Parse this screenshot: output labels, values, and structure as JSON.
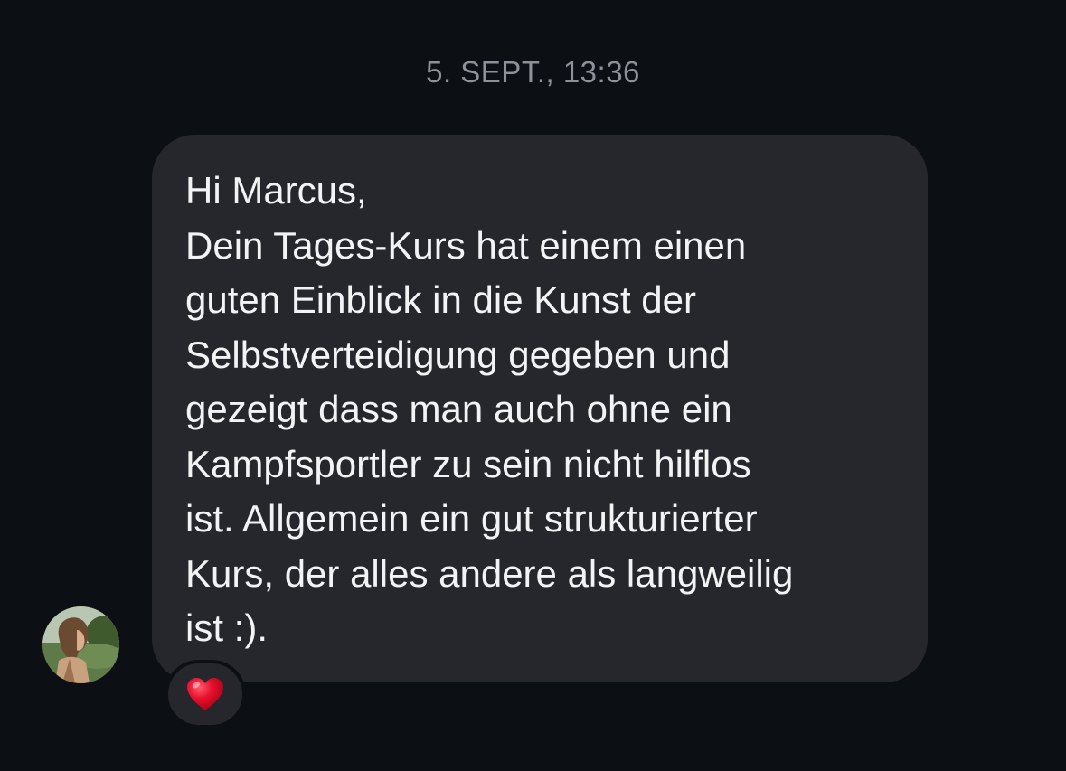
{
  "conversation": {
    "timestamp": "5. SEPT., 13:36"
  },
  "message": {
    "lines": [
      "Hi Marcus,",
      "Dein Tages-Kurs hat einem einen",
      "guten Einblick in die Kunst der",
      "Selbstverteidigung gegeben und",
      "gezeigt dass man auch ohne ein",
      "Kampfsportler zu sein nicht hilflos",
      "ist. Allgemein ein gut strukturierter",
      "Kurs, der alles andere als langweilig",
      "ist :)."
    ],
    "reaction": "heart-icon",
    "bubble_color": "#25272c",
    "text_color": "#f2f3f5"
  },
  "theme": {
    "background": "#0c0f14",
    "timestamp_color": "#8e9199",
    "heart_color": "#e8112d"
  }
}
